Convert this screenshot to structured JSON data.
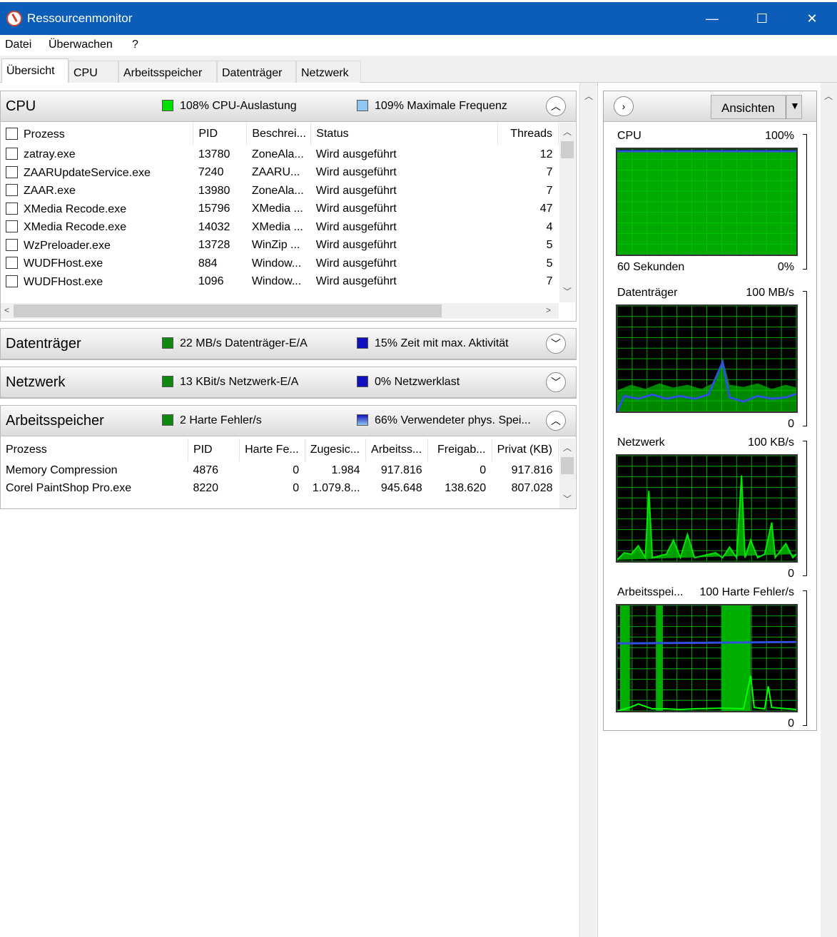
{
  "window": {
    "title": "Ressourcenmonitor",
    "minimize": "—",
    "maximize": "☐",
    "close": "✕"
  },
  "menu": [
    "Datei",
    "Überwachen",
    "?"
  ],
  "tabs": [
    "Übersicht",
    "CPU",
    "Arbeitsspeicher",
    "Datenträger",
    "Netzwerk"
  ],
  "cpu": {
    "title": "CPU",
    "metric1": "108% CPU-Auslastung",
    "metric2": "109% Maximale Frequenz",
    "color1": "#00e000",
    "color2": "#8ec8f2",
    "columns": [
      "Prozess",
      "PID",
      "Beschrei...",
      "Status",
      "Threads"
    ],
    "rows": [
      [
        "zatray.exe",
        "13780",
        "ZoneAla...",
        "Wird ausgeführt",
        "12"
      ],
      [
        "ZAARUpdateService.exe",
        "7240",
        "ZAARU...",
        "Wird ausgeführt",
        "7"
      ],
      [
        "ZAAR.exe",
        "13980",
        "ZoneAla...",
        "Wird ausgeführt",
        "7"
      ],
      [
        "XMedia Recode.exe",
        "15796",
        "XMedia ...",
        "Wird ausgeführt",
        "47"
      ],
      [
        "XMedia Recode.exe",
        "14032",
        "XMedia ...",
        "Wird ausgeführt",
        "4"
      ],
      [
        "WzPreloader.exe",
        "13728",
        "WinZip ...",
        "Wird ausgeführt",
        "5"
      ],
      [
        "WUDFHost.exe",
        "884",
        "Window...",
        "Wird ausgeführt",
        "5"
      ],
      [
        "WUDFHost.exe",
        "1096",
        "Window...",
        "Wird ausgeführt",
        "7"
      ]
    ]
  },
  "disk": {
    "title": "Datenträger",
    "metric1": "22 MB/s Datenträger-E/A",
    "metric2": "15% Zeit mit max. Aktivität"
  },
  "network": {
    "title": "Netzwerk",
    "metric1": "13 KBit/s Netzwerk-E/A",
    "metric2": "0% Netzwerklast"
  },
  "memory": {
    "title": "Arbeitsspeicher",
    "metric1": "2 Harte Fehler/s",
    "metric2": "66% Verwendeter phys. Spei...",
    "columns": [
      "Prozess",
      "PID",
      "Harte Fe...",
      "Zugesic...",
      "Arbeitss...",
      "Freigab...",
      "Privat (KB)"
    ],
    "rows": [
      [
        "Memory Compression",
        "4876",
        "0",
        "1.984",
        "917.816",
        "0",
        "917.816"
      ],
      [
        "Corel PaintShop Pro.exe",
        "8220",
        "0",
        "1.079.8...",
        "945.648",
        "138.620",
        "807.028"
      ]
    ]
  },
  "right": {
    "views_button": "Ansichten",
    "graphs": [
      {
        "name": "CPU",
        "max": "100%",
        "footer_left": "60 Sekunden",
        "footer_right": "0%"
      },
      {
        "name": "Datenträger",
        "max": "100 MB/s",
        "footer_left": "",
        "footer_right": "0"
      },
      {
        "name": "Netzwerk",
        "max": "100 KB/s",
        "footer_left": "",
        "footer_right": "0"
      },
      {
        "name": "Arbeitsspei...",
        "max": "100 Harte Fehler/s",
        "footer_left": "",
        "footer_right": "0"
      }
    ]
  }
}
